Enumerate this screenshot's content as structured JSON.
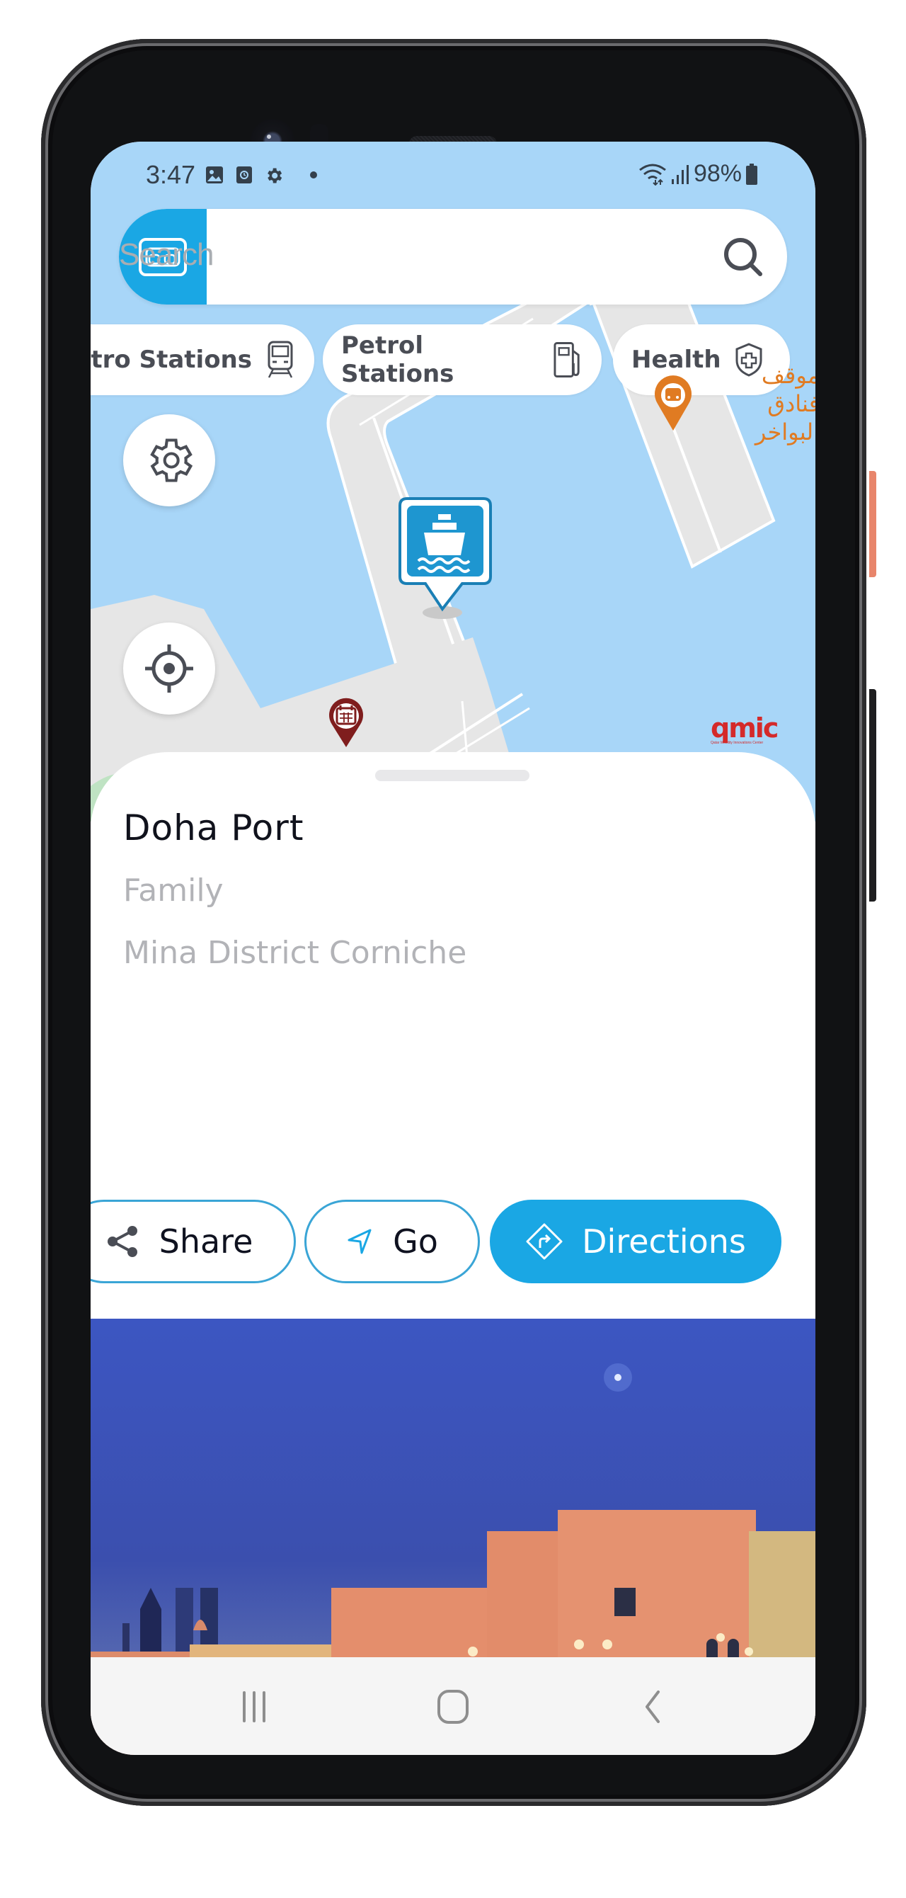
{
  "status_bar": {
    "time": "3:47",
    "notification_icons": [
      "gallery-icon",
      "screen-recorder-icon",
      "settings-icon",
      "dot-icon"
    ],
    "battery": "98%",
    "connectivity_icons": [
      "wifi-icon",
      "signal-icon",
      "battery-icon"
    ]
  },
  "search": {
    "placeholder": "Search",
    "value": "",
    "menu_icon": "card-menu-icon",
    "search_icon": "search-icon"
  },
  "categories": [
    {
      "label": "Metro Stations",
      "visible_label": "tro Stations",
      "icon": "train-icon"
    },
    {
      "label": "Petrol Stations",
      "icon": "fuel-pump-icon"
    },
    {
      "label": "Health",
      "icon": "shield-plus-icon"
    }
  ],
  "map": {
    "buttons": [
      {
        "name": "settings",
        "icon": "gear-icon"
      },
      {
        "name": "my-location",
        "icon": "crosshair-icon"
      }
    ],
    "markers": [
      {
        "name": "ferry-port-marker",
        "icon": "ship-icon",
        "color": "#1e96d0",
        "selected": true
      },
      {
        "name": "event-marker",
        "icon": "calendar-icon",
        "color": "#7f1d1d"
      },
      {
        "name": "bus-stop-marker",
        "icon": "bus-icon",
        "color": "#e07b22"
      }
    ],
    "labels": [
      {
        "text": "موقف",
        "color": "#e07b22"
      },
      {
        "text": "فنادق البواخر",
        "color": "#e07b22"
      }
    ],
    "logo": {
      "text": "qmic",
      "subtitle": "Qatar Mobility Innovations Center",
      "color": "#d42a2a"
    }
  },
  "place": {
    "title": "Doha Port",
    "category": "Family",
    "address": "Mina District Corniche"
  },
  "actions": {
    "share_label": "Share",
    "go_label": "Go",
    "directions_label": "Directions"
  },
  "photo": {
    "description": "Doha Port Mina District buildings illuminated at night by the water"
  },
  "nav_bar": {
    "recents": "recents-icon",
    "home": "home-icon",
    "back": "back-icon"
  },
  "colors": {
    "accent": "#1aa7e4",
    "map_water": "#a8d6f8",
    "map_land": "#e6e6e6",
    "title_text": "#10121c",
    "muted_text": "#b2b3b7"
  }
}
